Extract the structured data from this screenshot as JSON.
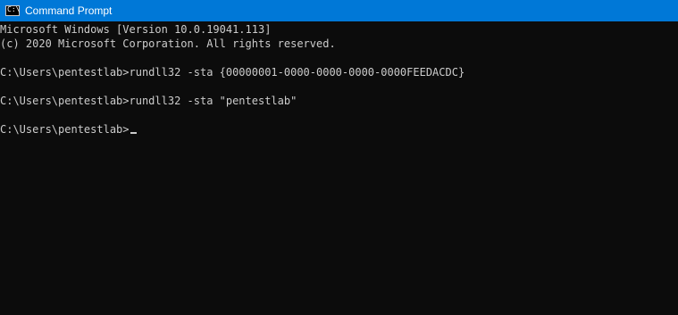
{
  "window": {
    "title": "Command Prompt",
    "icon": "console-icon",
    "icon_glyph": "C:\\",
    "accent_color": "#0078d7",
    "background_color": "#0c0c0c",
    "text_color": "#cccccc"
  },
  "console": {
    "lines": [
      "Microsoft Windows [Version 10.0.19041.113]",
      "(c) 2020 Microsoft Corporation. All rights reserved.",
      "",
      "C:\\Users\\pentestlab>rundll32 -sta {00000001-0000-0000-0000-0000FEEDACDC}",
      "",
      "C:\\Users\\pentestlab>rundll32 -sta \"pentestlab\"",
      "",
      "C:\\Users\\pentestlab>"
    ]
  }
}
